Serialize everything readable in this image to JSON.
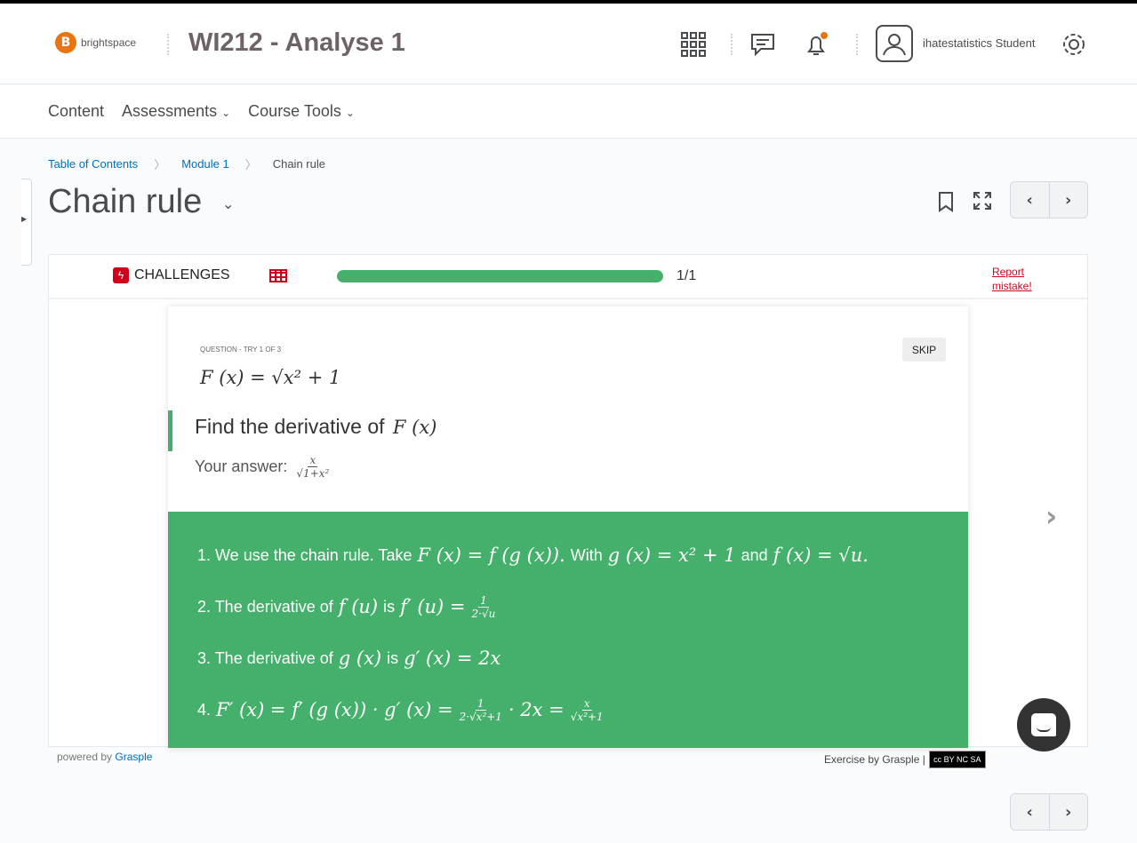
{
  "header": {
    "logo": "brightspace",
    "course_title": "WI212 - Analyse 1",
    "user": "ihatestatistics Student",
    "accent": "#e87511"
  },
  "nav": {
    "items": [
      "Content",
      "Assessments",
      "Course Tools"
    ]
  },
  "breadcrumb": [
    "Table of Contents",
    "Module 1",
    "Chain rule"
  ],
  "page": {
    "title": "Chain rule"
  },
  "challenge": {
    "label": "CHALLENGES",
    "progress_percent": 100,
    "progress_text": "1/1",
    "report": "Report mistake!",
    "progress_color": "#45b06b"
  },
  "question": {
    "label": "QUESTION - TRY 1 OF 3",
    "skip": "SKIP",
    "formula": "F (x) = √x² + 1",
    "prompt": "Find the derivative of",
    "prompt_math": "F (x)",
    "answer_label": "Your answer:",
    "answer_num": "x",
    "answer_den": "√1+x²"
  },
  "solution": {
    "steps": [
      [
        {
          "t": "1. We use the chain rule. Take"
        },
        {
          "m": "F (x) = f (g (x))."
        },
        {
          "t": "With"
        },
        {
          "m": "g (x) = x² + 1"
        },
        {
          "t": "and"
        },
        {
          "m": "f (x) = √u."
        }
      ],
      [
        {
          "t": "2. The derivative of"
        },
        {
          "m": "f (u)"
        },
        {
          "t": "is"
        },
        {
          "m": "f′ (u) ="
        },
        {
          "fn": "1",
          "fd": "2·√u"
        }
      ],
      [
        {
          "t": "3. The derivative of"
        },
        {
          "m": "g (x)"
        },
        {
          "t": "is"
        },
        {
          "m": "g′ (x) = 2x"
        }
      ],
      [
        {
          "t": "4."
        },
        {
          "m": "F′ (x) = f′ (g (x)) · g′ (x) ="
        },
        {
          "fn": "1",
          "fd": "2·√x²+1"
        },
        {
          "m": "· 2x ="
        },
        {
          "fn": "x",
          "fd": "√x²+1"
        }
      ]
    ],
    "color": "#45b06b"
  },
  "footer": {
    "powered": "powered by",
    "grasple": "Grasple",
    "exercise": "Exercise by Grasple |",
    "license": "cc BY NC SA"
  }
}
